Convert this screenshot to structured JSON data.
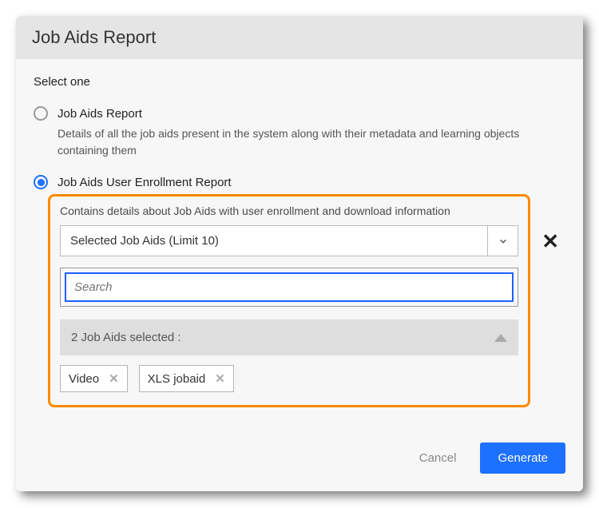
{
  "header": {
    "title": "Job Aids Report"
  },
  "prompt": "Select one",
  "options": {
    "report": {
      "label": "Job Aids Report",
      "desc": "Details of all the job aids present in the system along with their metadata and learning objects containing them"
    },
    "enrollment": {
      "label": "Job Aids User Enrollment Report",
      "desc": "Contains details about Job Aids with user enrollment and download information"
    }
  },
  "select": {
    "label": "Selected Job Aids (Limit 10)"
  },
  "search": {
    "placeholder": "Search"
  },
  "selected_count_text": "2 Job Aids selected :",
  "chips": [
    "Video",
    "XLS jobaid"
  ],
  "footer": {
    "cancel": "Cancel",
    "generate": "Generate"
  }
}
